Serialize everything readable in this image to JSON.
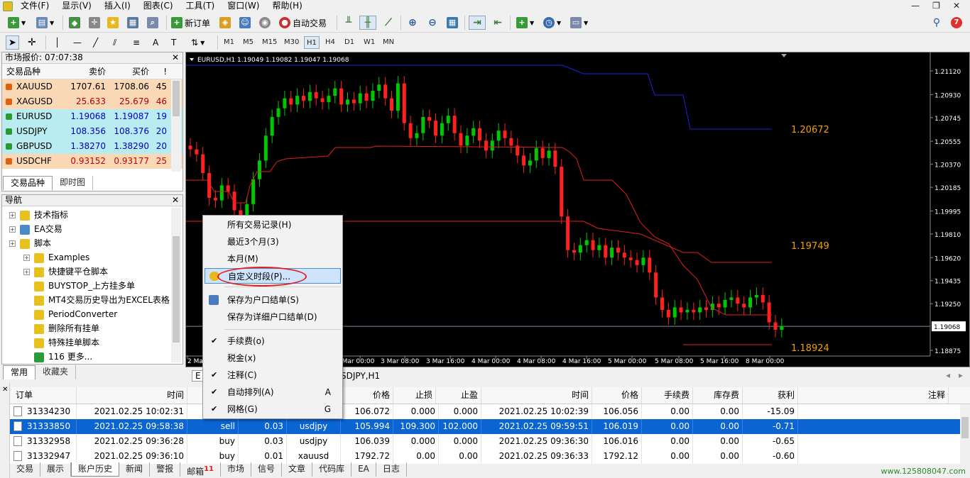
{
  "menu": [
    "文件(F)",
    "显示(V)",
    "插入(I)",
    "图表(C)",
    "工具(T)",
    "窗口(W)",
    "帮助(H)"
  ],
  "toolbar": {
    "new_order": "新订单",
    "auto_trade": "自动交易"
  },
  "timeframes": [
    "M1",
    "M5",
    "M15",
    "M30",
    "H1",
    "H4",
    "D1",
    "W1",
    "MN"
  ],
  "active_timeframe": "H1",
  "notification_count": "7",
  "market_watch": {
    "title": "市场报价: 07:07:38",
    "headers": [
      "交易品种",
      "卖价",
      "买价",
      "!"
    ],
    "rows": [
      {
        "symbol": "XAUUSD",
        "bid": "1707.61",
        "ask": "1708.06",
        "spread": "45",
        "dir": "down",
        "bg": "#fcd9b6",
        "color": "#000"
      },
      {
        "symbol": "XAGUSD",
        "bid": "25.633",
        "ask": "25.679",
        "spread": "46",
        "dir": "down",
        "bg": "#fcd9b6",
        "color": "#b00000"
      },
      {
        "symbol": "EURUSD",
        "bid": "1.19068",
        "ask": "1.19087",
        "spread": "19",
        "dir": "up",
        "bg": "#b8ecf0",
        "color": "#0000c8"
      },
      {
        "symbol": "USDJPY",
        "bid": "108.356",
        "ask": "108.376",
        "spread": "20",
        "dir": "up",
        "bg": "#b8ecf0",
        "color": "#0000c8"
      },
      {
        "symbol": "GBPUSD",
        "bid": "1.38270",
        "ask": "1.38290",
        "spread": "20",
        "dir": "up",
        "bg": "#b8ecf0",
        "color": "#0000c8"
      },
      {
        "symbol": "USDCHF",
        "bid": "0.93152",
        "ask": "0.93177",
        "spread": "25",
        "dir": "down",
        "bg": "#fcd9b6",
        "color": "#c80000"
      }
    ],
    "tabs": [
      "交易品种",
      "即时图"
    ]
  },
  "navigator": {
    "title": "导航",
    "items": [
      {
        "label": "技术指标",
        "indent": 0,
        "plus": true
      },
      {
        "label": "EA交易",
        "indent": 0,
        "plus": true
      },
      {
        "label": "脚本",
        "indent": 0,
        "plus": true
      },
      {
        "label": "Examples",
        "indent": 1,
        "plus": true
      },
      {
        "label": "快捷键平仓脚本",
        "indent": 1,
        "plus": true
      },
      {
        "label": "BUYSTOP_上方挂多单",
        "indent": 1,
        "plus": false
      },
      {
        "label": "MT4交易历史导出为EXCEL表格",
        "indent": 1,
        "plus": false
      },
      {
        "label": "PeriodConverter",
        "indent": 1,
        "plus": false
      },
      {
        "label": "删除所有挂单",
        "indent": 1,
        "plus": false
      },
      {
        "label": "特殊挂单脚本",
        "indent": 1,
        "plus": false
      },
      {
        "label": "116 更多...",
        "indent": 1,
        "plus": false
      }
    ],
    "tabs": [
      "常用",
      "收藏夹"
    ]
  },
  "chart": {
    "header": "EURUSD,H1  1.19049 1.19082 1.19047 1.19068",
    "price_ticks": [
      "1.21120",
      "1.20930",
      "1.20745",
      "1.20555",
      "1.20370",
      "1.20185",
      "1.19995",
      "1.19810",
      "1.19620",
      "1.19435",
      "1.19250",
      "1.19068",
      "1.18875"
    ],
    "current_price": "1.19068",
    "time_ticks": [
      "2 Mar",
      "",
      "3 Mar 00:00",
      "3 Mar 08:00",
      "3 Mar 16:00",
      "4 Mar 00:00",
      "4 Mar 08:00",
      "4 Mar 16:00",
      "5 Mar 00:00",
      "5 Mar 08:00",
      "5 Mar 16:00",
      "8 Mar 00:00"
    ],
    "levels": [
      "1.20672",
      "1.19749",
      "1.18924"
    ],
    "tabs": [
      "E",
      "SDJPY,H1"
    ]
  },
  "context_menu": {
    "items": [
      "所有交易记录(H)",
      "最近3个月(3)",
      "本月(M)",
      "自定义时段(P)...",
      "保存为户口结单(S)",
      "保存为详细户口结单(D)",
      "手续费(o)",
      "税金(x)",
      "注释(C)",
      "自动排列(A)",
      "网格(G)"
    ],
    "shortcuts": {
      "auto": "A",
      "grid": "G"
    }
  },
  "terminal": {
    "headers": [
      "订单",
      "时间",
      "",
      "价格",
      "止损",
      "止盈",
      "时间",
      "价格",
      "手续费",
      "库存费",
      "获利",
      "注释"
    ],
    "rows": [
      [
        "31334230",
        "2021.02.25 10:02:31",
        "",
        "",
        "",
        "106.072",
        "0.000",
        "0.000",
        "2021.02.25 10:02:39",
        "106.056",
        "0.00",
        "0.00",
        "-15.09"
      ],
      [
        "31333850",
        "2021.02.25 09:58:38",
        "sell",
        "0.03",
        "usdjpy",
        "105.994",
        "109.300",
        "102.000",
        "2021.02.25 09:59:51",
        "106.019",
        "0.00",
        "0.00",
        "-0.71"
      ],
      [
        "31332958",
        "2021.02.25 09:36:28",
        "buy",
        "0.03",
        "usdjpy",
        "106.039",
        "0.000",
        "0.000",
        "2021.02.25 09:36:30",
        "106.016",
        "0.00",
        "0.00",
        "-0.65"
      ],
      [
        "31332947",
        "2021.02.25 09:36:10",
        "buy",
        "0.01",
        "xauusd",
        "1792.72",
        "0.00",
        "0.00",
        "2021.02.25 09:36:33",
        "1792.12",
        "0.00",
        "0.00",
        "-0.60"
      ]
    ],
    "tabs": [
      "交易",
      "展示",
      "账户历史",
      "新闻",
      "警报",
      "邮箱",
      "市场",
      "信号",
      "文章",
      "代码库",
      "EA",
      "日志"
    ],
    "mail_badge": "11",
    "active_tab": "账户历史"
  },
  "watermark": "www.125808047.com",
  "colors": {
    "bull": "#00c800",
    "bear": "#ff2020",
    "blue_line": "#2020e0",
    "red_line": "#e02020",
    "level_text": "#f0a000"
  }
}
